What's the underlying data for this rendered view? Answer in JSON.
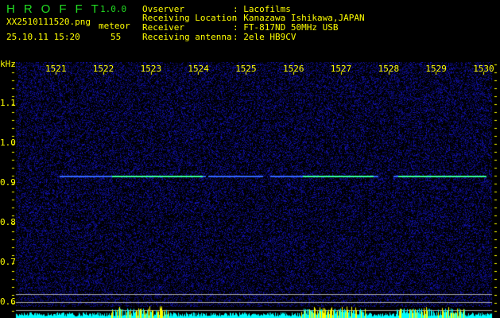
{
  "app": {
    "logo": "HROFFT",
    "version": "1.0.0"
  },
  "file": {
    "name": "XX2510111520.png",
    "datetime": "25.10.11 15:20"
  },
  "meteor": {
    "label": "meteor",
    "count": "55"
  },
  "info": [
    {
      "label": "Ovserver",
      "value": ": Lacofilms"
    },
    {
      "label": "Receiving Location",
      "value": ": Kanazawa Ishikawa,JAPAN"
    },
    {
      "label": "Receiver",
      "value": ": FT-817ND 50MHz USB"
    },
    {
      "label": "Receiving antenna",
      "value": ": 2ele HB9CV"
    }
  ],
  "axis": {
    "unit": "kHz",
    "freq_ticks": [
      "1521",
      "1522",
      "1523",
      "1524",
      "1525",
      "1526",
      "1527",
      "1528",
      "1529",
      "1530"
    ],
    "y_ticks": [
      "1.1",
      "1.0",
      "0.9",
      "0.8",
      "0.7",
      "0.6"
    ]
  },
  "colors": {
    "background": "#000000",
    "text": "#ffff00",
    "logo": "#22dd22",
    "noise": "#1a1aa0",
    "signal": "#33ff99",
    "bars": "#00ffff",
    "peaks": "#ffff00"
  }
}
